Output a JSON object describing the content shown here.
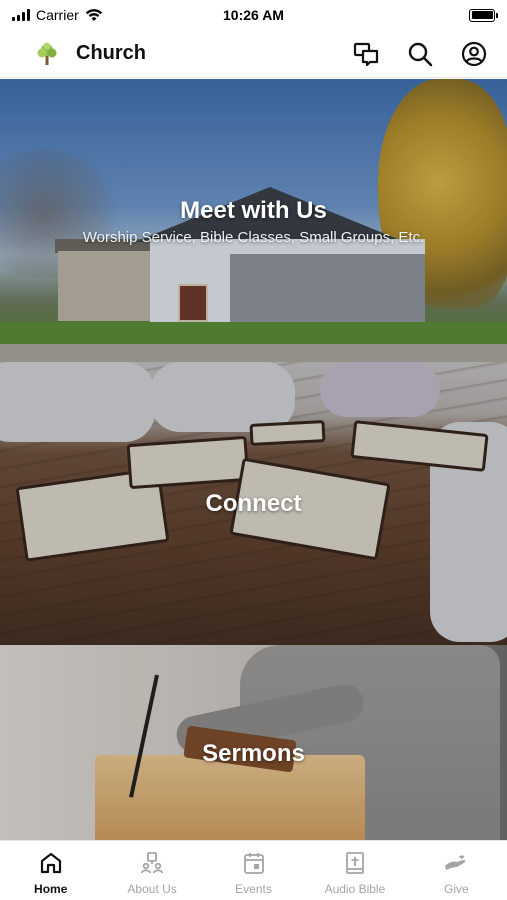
{
  "status_bar": {
    "carrier": "Carrier",
    "time": "10:26 AM"
  },
  "header": {
    "title": "Church",
    "logo_icon": "tree-icon",
    "actions": [
      "chat-icon",
      "search-icon",
      "profile-icon"
    ]
  },
  "feed": {
    "panels": [
      {
        "title": "Meet with Us",
        "subtitle": "Worship Service, Bible Classes, Small Groups, Etc."
      },
      {
        "title": "Connect"
      },
      {
        "title": "Sermons"
      }
    ]
  },
  "tabs": [
    {
      "label": "Home",
      "icon": "home-icon",
      "active": true
    },
    {
      "label": "About Us",
      "icon": "people-icon",
      "active": false
    },
    {
      "label": "Events",
      "icon": "calendar-icon",
      "active": false
    },
    {
      "label": "Audio Bible",
      "icon": "bible-icon",
      "active": false
    },
    {
      "label": "Give",
      "icon": "give-hand-icon",
      "active": false
    }
  ],
  "colors": {
    "active_tab": "#111111",
    "inactive_tab": "#a5a5a5",
    "panel_text": "#ffffff"
  }
}
